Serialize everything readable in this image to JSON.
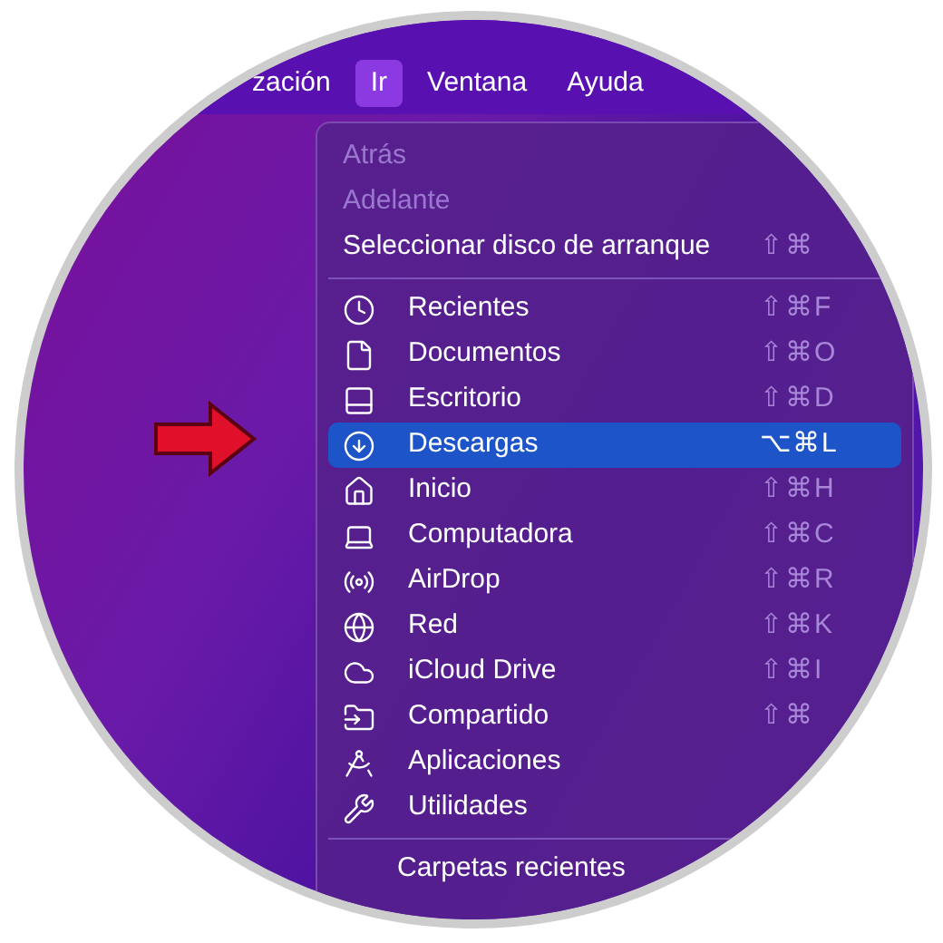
{
  "menu_bar": [
    {
      "label": "zación",
      "selected": false
    },
    {
      "label": "Ir",
      "selected": true
    },
    {
      "label": "Ventana",
      "selected": false
    },
    {
      "label": "Ayuda",
      "selected": false
    }
  ],
  "menu": {
    "sections": [
      {
        "items": [
          {
            "label": "Atrás",
            "disabled": true,
            "selected": false
          },
          {
            "label": "Adelante",
            "disabled": true,
            "selected": false
          },
          {
            "label": "Seleccionar disco de arranque",
            "shortcut": "⇧⌘",
            "disabled": false,
            "selected": false
          }
        ]
      },
      {
        "items": [
          {
            "label": "Recientes",
            "shortcut": "⇧⌘F",
            "disabled": false,
            "selected": false
          },
          {
            "label": "Documentos",
            "shortcut": "⇧⌘O",
            "disabled": false,
            "selected": false
          },
          {
            "label": "Escritorio",
            "shortcut": "⇧⌘D",
            "disabled": false,
            "selected": false
          },
          {
            "label": "Descargas",
            "shortcut": "⌥⌘L",
            "disabled": false,
            "selected": true
          },
          {
            "label": "Inicio",
            "shortcut": "⇧⌘H",
            "disabled": false,
            "selected": false
          },
          {
            "label": "Computadora",
            "shortcut": "⇧⌘C",
            "disabled": false,
            "selected": false
          },
          {
            "label": "AirDrop",
            "shortcut": "⇧⌘R",
            "disabled": false,
            "selected": false
          },
          {
            "label": "Red",
            "shortcut": "⇧⌘K",
            "disabled": false,
            "selected": false
          },
          {
            "label": "iCloud Drive",
            "shortcut": "⇧⌘I",
            "disabled": false,
            "selected": false
          },
          {
            "label": "Compartido",
            "shortcut": "⇧⌘",
            "disabled": false,
            "selected": false
          },
          {
            "label": "Aplicaciones",
            "disabled": false,
            "selected": false
          },
          {
            "label": "Utilidades",
            "disabled": false,
            "selected": false
          }
        ]
      },
      {
        "items": [
          {
            "label": "Carpetas recientes",
            "disabled": false,
            "selected": false
          }
        ]
      }
    ]
  }
}
